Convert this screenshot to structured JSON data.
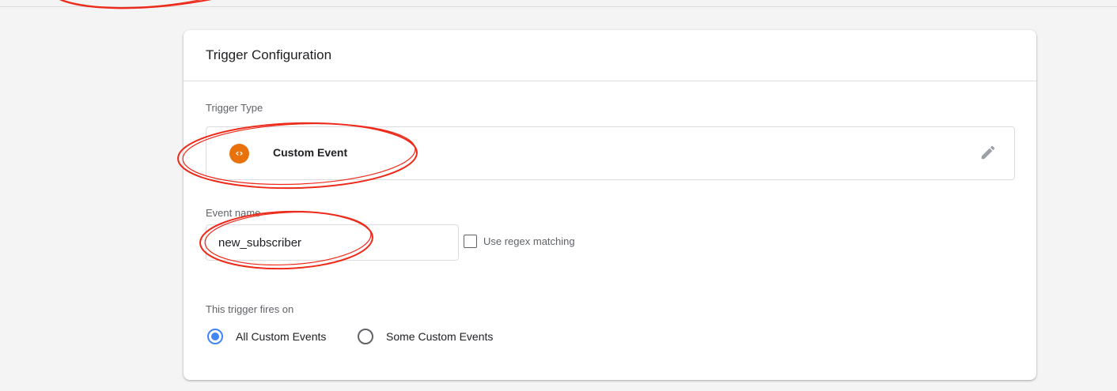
{
  "card": {
    "title": "Trigger Configuration"
  },
  "trigger_type": {
    "label": "Trigger Type",
    "name": "Custom Event",
    "icon": "custom-event-code-icon",
    "icon_glyph": "‹›",
    "icon_color": "#e8710a",
    "edit_icon": "pencil-icon"
  },
  "event_name": {
    "label": "Event name",
    "value": "new_subscriber",
    "regex_label": "Use regex matching",
    "regex_checked": false
  },
  "fires_on": {
    "label": "This trigger fires on",
    "options": [
      {
        "label": "All Custom Events",
        "selected": true
      },
      {
        "label": "Some Custom Events",
        "selected": false
      }
    ]
  },
  "colors": {
    "accent": "#4285f4",
    "annotation": "#ee2a1b"
  }
}
